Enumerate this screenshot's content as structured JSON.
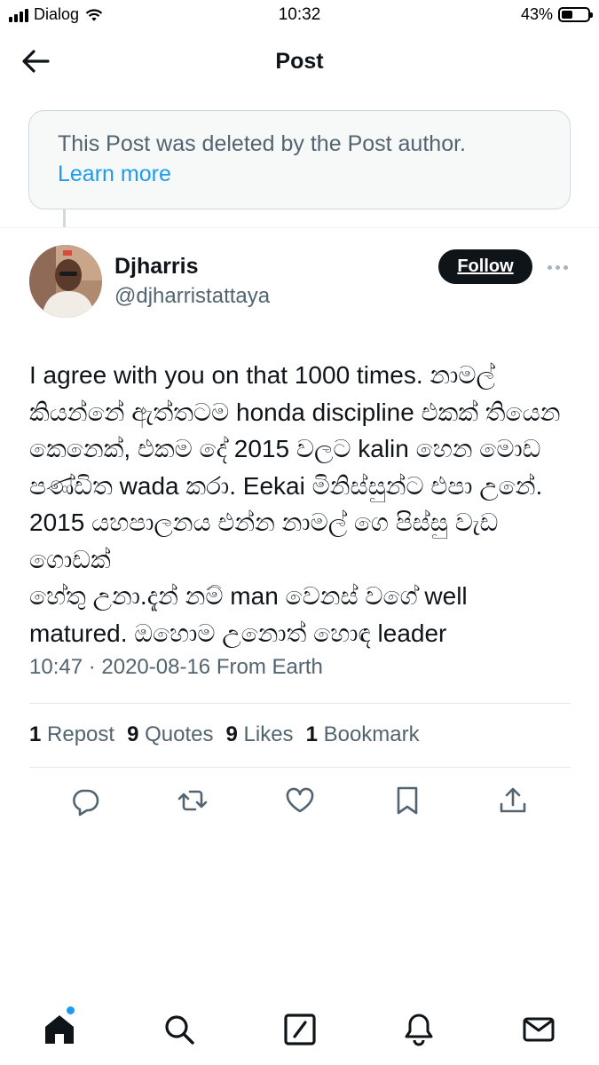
{
  "status_bar": {
    "carrier": "Dialog",
    "time": "10:32",
    "battery": "43%",
    "battery_level": 0.43
  },
  "header": {
    "title": "Post",
    "back_icon": "arrow-left-icon"
  },
  "deleted_notice": {
    "message": "This Post was deleted by the Post author.",
    "link": "Learn more"
  },
  "author": {
    "name": "Djharris",
    "handle": "@djharristattaya",
    "follow_label": "Follow"
  },
  "post": {
    "text": "I agree with you on that 1000 times. නාමල්\nකියන්නේ ඇත්තටම honda discipline එකක් තියෙන\nකෙනෙක්, එකම දේ 2015 වලට kalin හෙන මොඩ\nපණ්ඩිත wada කරා. Eekai මිනිස්සුන්ට එපා උනේ.\n2015 යහපාලනය එන්න නාමල් ගෙ පිස්සු වැඩ ගොඩක්\nහේතු උනා.දැන් නම් man වෙනස් වගේ well\nmatured. ඔහොම උනොත් හොඳ leader",
    "timestamp": "10:47 · 2020-08-16 From Earth"
  },
  "stats": {
    "reposts_count": "1",
    "reposts_label": "Repost",
    "quotes_count": "9",
    "quotes_label": "Quotes",
    "likes_count": "9",
    "likes_label": "Likes",
    "bookmarks_count": "1",
    "bookmarks_label": "Bookmark"
  },
  "actions": [
    "reply-icon",
    "repost-icon",
    "like-icon",
    "bookmark-icon",
    "share-icon"
  ],
  "tab_bar": [
    "home-icon",
    "search-icon",
    "compose-icon",
    "notifications-icon",
    "messages-icon"
  ],
  "colors": {
    "accent": "#1d9bf0",
    "text": "#0f1419",
    "secondary": "#536471",
    "follow_bg": "#0f1419"
  }
}
